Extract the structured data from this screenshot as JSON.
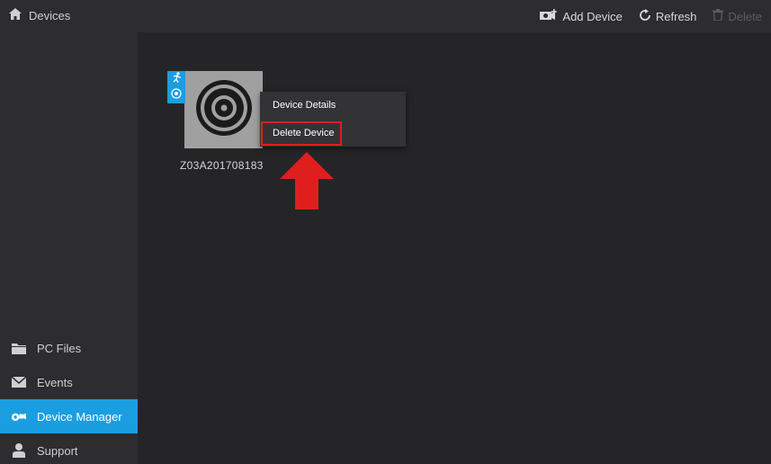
{
  "sidebar": {
    "header_label": "Devices",
    "header_icon": "home-icon",
    "items": [
      {
        "label": "PC Files",
        "icon": "folder-icon",
        "active": false
      },
      {
        "label": "Events",
        "icon": "envelope-icon",
        "active": false
      },
      {
        "label": "Device Manager",
        "icon": "camera-device-icon",
        "active": true
      },
      {
        "label": "Support",
        "icon": "person-icon",
        "active": false
      }
    ]
  },
  "toolbar": {
    "add_device_label": "Add Device",
    "refresh_label": "Refresh",
    "delete_label": "Delete"
  },
  "device": {
    "name": "Z03A201708183"
  },
  "context_menu": {
    "details_label": "Device Details",
    "delete_label": "Delete Device"
  },
  "colors": {
    "accent": "#1a9ee0",
    "highlight": "#e01e1e",
    "background": "#252527",
    "panel": "#2d2d30"
  }
}
